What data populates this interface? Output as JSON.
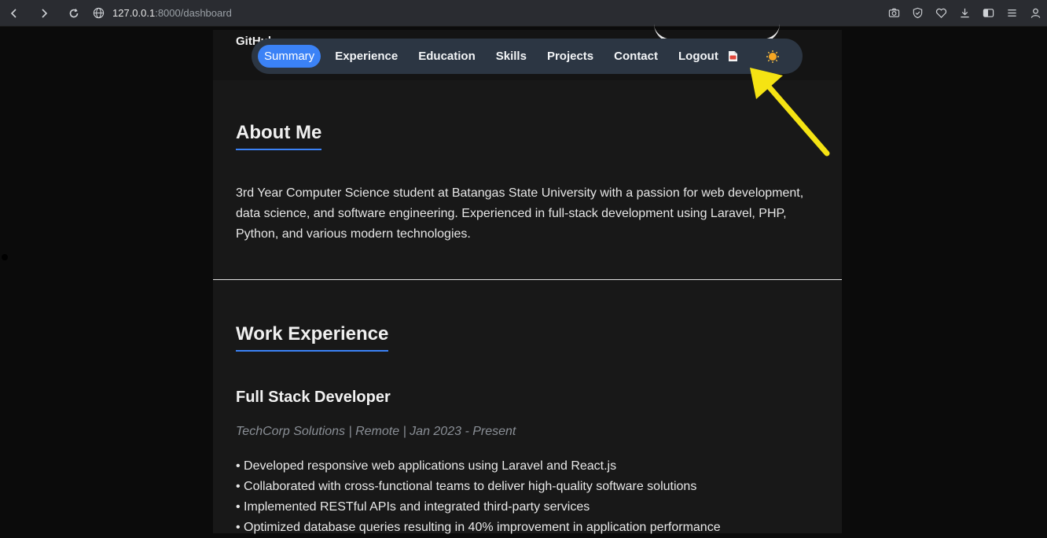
{
  "browser": {
    "url_host": "127.0.0.1",
    "url_path": ":8000/dashboard"
  },
  "header": {
    "github_label": "GitHub"
  },
  "nav": {
    "items": [
      "Summary",
      "Experience",
      "Education",
      "Skills",
      "Projects",
      "Contact",
      "Logout"
    ],
    "active": "Summary",
    "doc_icon": "document-icon",
    "theme_icon": "sun-icon"
  },
  "about": {
    "title": "About Me",
    "text": "3rd Year Computer Science student at Batangas State University with a passion for web development, data science, and software engineering. Experienced in full-stack development using Laravel, PHP, Python, and various modern technologies."
  },
  "experience": {
    "title": "Work Experience",
    "job": {
      "title": "Full Stack Developer",
      "meta": "TechCorp Solutions | Remote | Jan 2023 - Present",
      "bullets": [
        "• Developed responsive web applications using Laravel and React.js",
        "• Collaborated with cross-functional teams to deliver high-quality software solutions",
        "• Implemented RESTful APIs and integrated third-party services",
        "• Optimized database queries resulting in 40% improvement in application performance"
      ]
    }
  },
  "colors": {
    "accent": "#3b82f6",
    "annotation_arrow": "#f5e313"
  }
}
